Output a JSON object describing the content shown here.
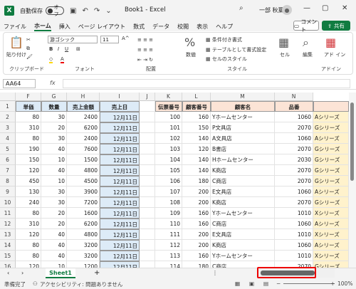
{
  "titlebar": {
    "logo": "X",
    "autosave": "自動保存",
    "toggle": "オフ",
    "title": "Book1 - Excel",
    "user": "一部 秋葉",
    "search_icon": "search-icon"
  },
  "menu": [
    "ファイル",
    "ホーム",
    "挿入",
    "ページ レイアウト",
    "数式",
    "データ",
    "校閲",
    "表示",
    "ヘルプ"
  ],
  "comment": "コメント",
  "share": "共有",
  "ribbon": {
    "paste": "貼り付け",
    "clipboard": "クリップボード",
    "font_name": "游ゴシック",
    "font_size": "11",
    "font": "フォント",
    "align": "配置",
    "number": "数値",
    "cond": "条件付き書式",
    "table": "テーブルとして書式設定",
    "cellstyle": "セルのスタイル",
    "style": "スタイル",
    "cell": "セル",
    "edit": "編集",
    "addin": "アド イン",
    "addin_grp": "アドイン"
  },
  "namebox": "AA64",
  "fx": "fx",
  "cols": [
    "F",
    "G",
    "H",
    "I",
    "J",
    "K",
    "L",
    "M",
    "N"
  ],
  "left_headers": [
    "単価",
    "数量",
    "売上金額",
    "売上日"
  ],
  "right_headers": [
    "伝票番号",
    "顧客番号",
    "顧客名",
    "品番",
    ""
  ],
  "rows": [
    [
      "80",
      "30",
      "2400",
      "12月11日",
      "100",
      "160",
      "Yホームセンター",
      "1060",
      "Aシリーズ"
    ],
    [
      "310",
      "20",
      "6200",
      "12月11日",
      "101",
      "150",
      "P文具店",
      "2070",
      "Gシリーズ"
    ],
    [
      "80",
      "30",
      "2400",
      "12月11日",
      "102",
      "140",
      "A文具店",
      "1060",
      "Aシリーズ"
    ],
    [
      "190",
      "40",
      "7600",
      "12月11日",
      "103",
      "120",
      "B書店",
      "2070",
      "Gシリーズ"
    ],
    [
      "150",
      "10",
      "1500",
      "12月11日",
      "104",
      "140",
      "Hホームセンター",
      "2030",
      "Gシリーズ"
    ],
    [
      "120",
      "40",
      "4800",
      "12月11日",
      "105",
      "140",
      "K商店",
      "2070",
      "Gシリーズ"
    ],
    [
      "450",
      "10",
      "4500",
      "12月11日",
      "106",
      "180",
      "C商店",
      "2070",
      "Gシリーズ"
    ],
    [
      "130",
      "30",
      "3900",
      "12月11日",
      "107",
      "200",
      "E文具店",
      "1060",
      "Aシリーズ"
    ],
    [
      "240",
      "30",
      "7200",
      "12月11日",
      "108",
      "200",
      "K商店",
      "2070",
      "Gシリーズ"
    ],
    [
      "80",
      "20",
      "1600",
      "12月11日",
      "109",
      "160",
      "Yホームセンター",
      "1010",
      "Xシリーズ"
    ],
    [
      "310",
      "20",
      "6200",
      "12月11日",
      "110",
      "160",
      "C商店",
      "1060",
      "Aシリーズ"
    ],
    [
      "120",
      "40",
      "4800",
      "12月11日",
      "111",
      "200",
      "E文具店",
      "1010",
      "Xシリーズ"
    ],
    [
      "80",
      "40",
      "3200",
      "12月11日",
      "112",
      "200",
      "K商店",
      "1060",
      "Aシリーズ"
    ],
    [
      "80",
      "40",
      "3200",
      "12月11日",
      "113",
      "160",
      "Yホームセンター",
      "1010",
      "Xシリーズ"
    ],
    [
      "120",
      "10",
      "1200",
      "12月11日",
      "114",
      "180",
      "C商店",
      "2070",
      "Gシリーズ"
    ]
  ],
  "sheet": "Sheet1",
  "status": {
    "ready": "準備完了",
    "access": "アクセシビリティ: 問題ありません",
    "zoom": "100%"
  }
}
